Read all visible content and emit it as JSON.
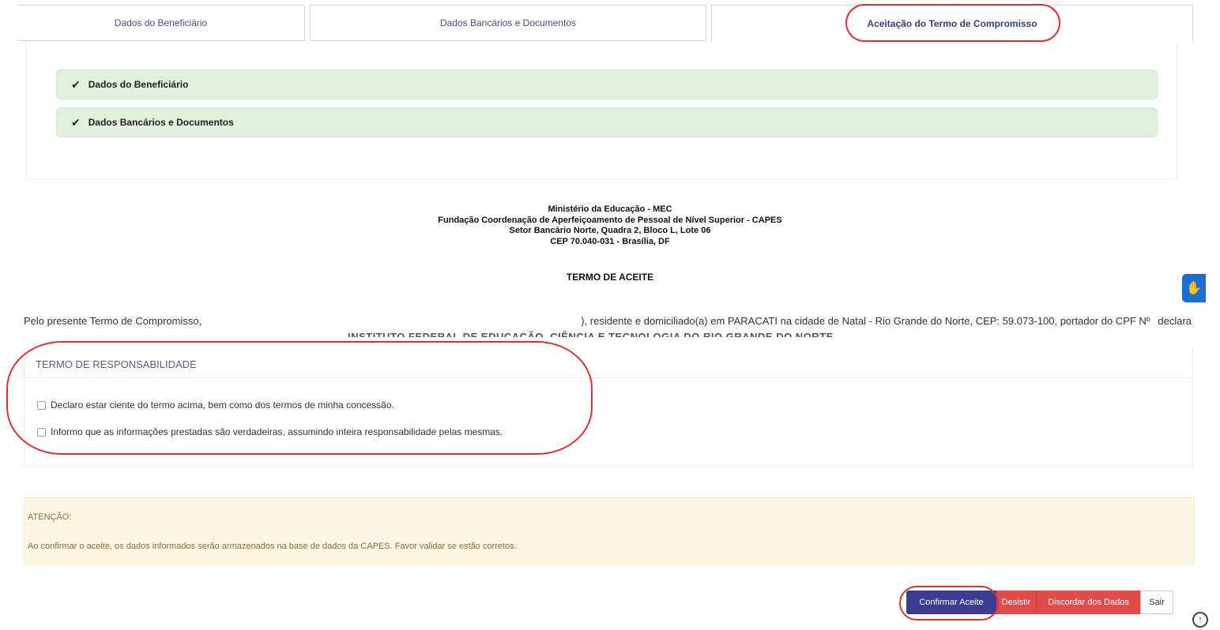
{
  "tabs": [
    {
      "label": "Dados do Beneficiário"
    },
    {
      "label": "Dados Bancários e Documentos"
    },
    {
      "label": "Aceitação do Termo de Compromisso"
    }
  ],
  "progress": {
    "steps": [
      {
        "label": "Dados do Beneficiário"
      },
      {
        "label": "Dados Bancários e Documentos"
      }
    ]
  },
  "header": {
    "line1": "Ministério da Educação - MEC",
    "line2": "Fundação Coordenação de Aperfeiçoamento de Pessoal de Nível Superior - CAPES",
    "line3": "Setor Bancário Norte, Quadra 2, Bloco L, Lote 06",
    "line4": "CEP 70.040-031 - Brasília, DF",
    "title": "TERMO DE ACEITE"
  },
  "body": {
    "part1": "Pelo presente Termo de Compromisso,",
    "part2": "), residente e domiciliado(a) em PARACATI na cidade de",
    "part3": "Natal - Rio Grande do Norte, CEP: 59.073-100, portador do CPF Nº",
    "part4": "declara",
    "line2": "INSTITUTO FEDERAL DE EDUCAÇÃO, CIÊNCIA E TECNOLOGIA DO RIO GRANDE DO NORTE"
  },
  "responsibility": {
    "title": "TERMO DE RESPONSABILIDADE",
    "check1": "Declaro estar ciente do termo acima, bem como dos termos de minha concessão.",
    "check2": "Informo que as informações prestadas são verdadeiras, assumindo inteira responsabilidade pelas mesmas."
  },
  "attention": {
    "title": "ATENÇÃO:",
    "text": "Ao confirmar o aceite, os dados informados serão armazenados na base de dados da CAPES. Favor validar se estão corretos."
  },
  "buttons": {
    "confirm": "Confirmar Aceite",
    "desistir": "Desistir",
    "discordar": "Discordar dos Dados",
    "sair": "Sair"
  },
  "icons": {
    "check": "check-icon",
    "accessibility": "accessibility-icon",
    "scroll_top": "arrow-up-circle-icon"
  },
  "colors": {
    "primary": "#3b3b8f",
    "danger": "#e04b4b",
    "success_bg": "#e3efdd",
    "warning_bg": "#fbf6e1",
    "annotation": "#e03131"
  }
}
